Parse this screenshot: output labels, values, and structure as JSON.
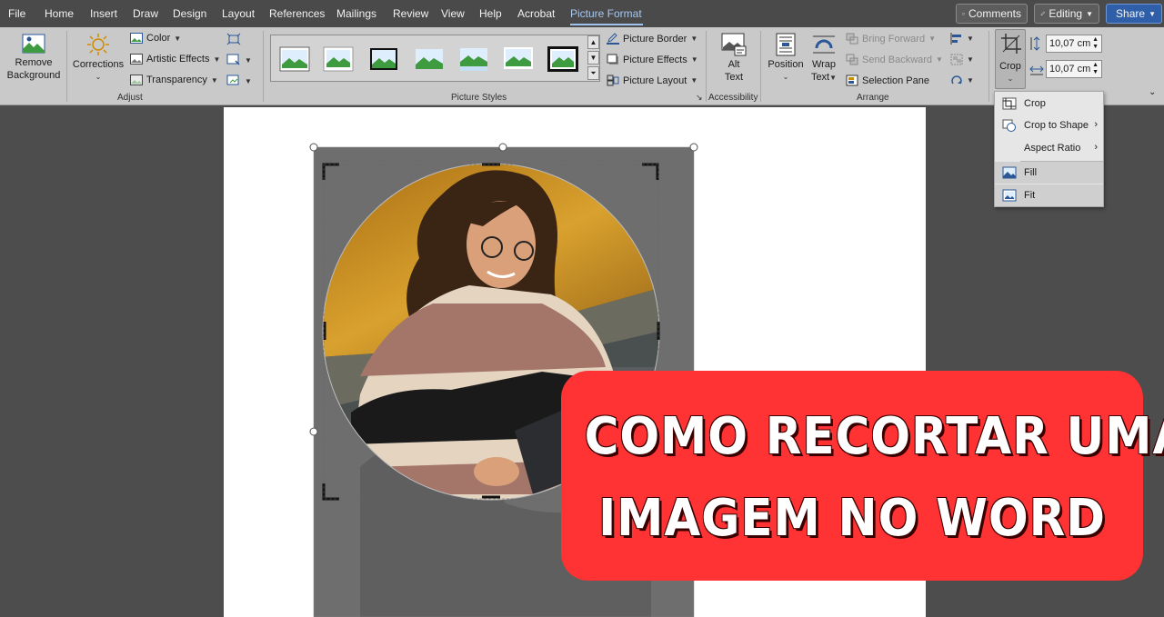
{
  "menubar": {
    "tabs": [
      "File",
      "Home",
      "Insert",
      "Draw",
      "Design",
      "Layout",
      "References",
      "Mailings",
      "Review",
      "View",
      "Help",
      "Acrobat",
      "Picture Format"
    ],
    "active_tab": "Picture Format",
    "comments_label": "Comments",
    "editing_label": "Editing",
    "share_label": "Share"
  },
  "ribbon": {
    "adjust": {
      "remove_background": [
        "Remove",
        "Background"
      ],
      "corrections": "Corrections",
      "color": "Color",
      "artistic_effects": "Artistic Effects",
      "transparency": "Transparency",
      "group_label": "Adjust"
    },
    "picture_styles": {
      "group_label": "Picture Styles",
      "picture_border": "Picture Border",
      "picture_effects": "Picture Effects",
      "picture_layout": "Picture Layout"
    },
    "accessibility": {
      "alt_text": [
        "Alt",
        "Text"
      ],
      "group_label": "Accessibility"
    },
    "arrange": {
      "position": "Position",
      "wrap_text": [
        "Wrap",
        "Text"
      ],
      "bring_forward": "Bring Forward",
      "send_backward": "Send Backward",
      "selection_pane": "Selection Pane",
      "group_label": "Arrange"
    },
    "size": {
      "crop": "Crop",
      "height": "10,07 cm",
      "width": "10,07 cm"
    }
  },
  "crop_menu": {
    "items": [
      {
        "label": "Crop",
        "icon": "crop-icon",
        "submenu": false
      },
      {
        "label": "Crop to Shape",
        "icon": "shape-icon",
        "submenu": true
      },
      {
        "label": "Aspect Ratio",
        "icon": "",
        "submenu": true
      },
      {
        "label": "Fill",
        "icon": "fill-icon",
        "submenu": false
      },
      {
        "label": "Fit",
        "icon": "fit-icon",
        "submenu": false
      }
    ]
  },
  "banner": {
    "line1": "COMO RECORTAR UMA",
    "line2": "IMAGEM NO WORD",
    "color": "#ff3333"
  }
}
